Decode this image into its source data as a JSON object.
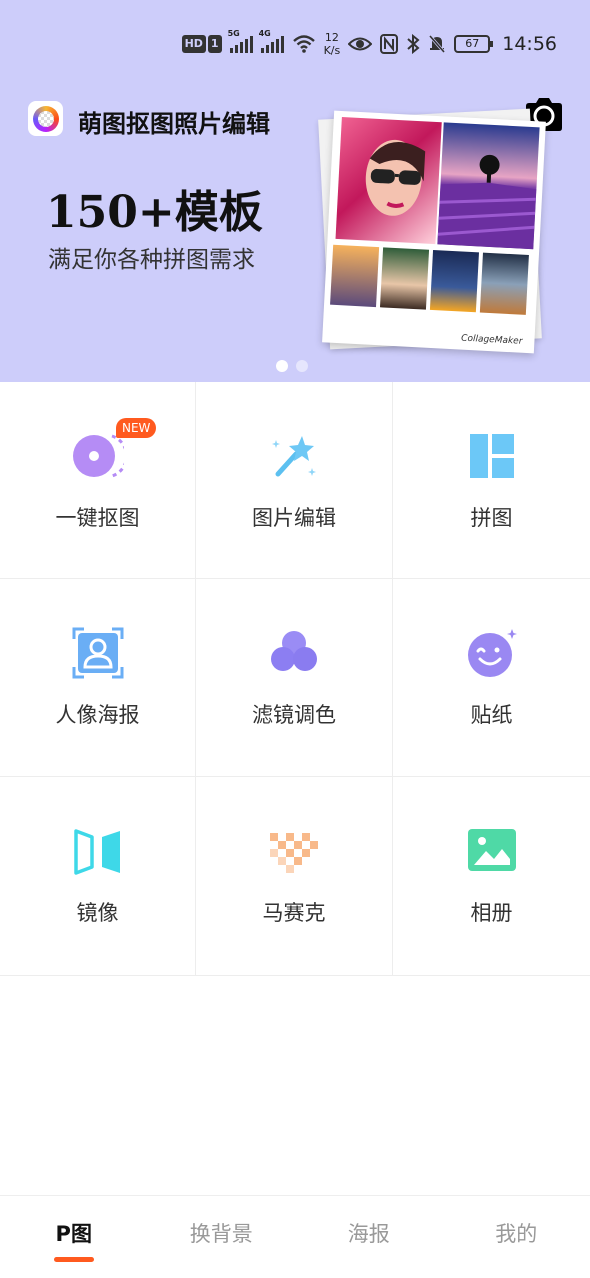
{
  "status_bar": {
    "hd_label": "HD",
    "sim_label": "1",
    "net1": "5G",
    "net2": "4G",
    "speed_value": "12",
    "speed_unit": "K/s",
    "battery": "67",
    "time": "14:56"
  },
  "banner": {
    "app_title": "萌图抠图照片编辑",
    "headline": "150+模板",
    "subtitle": "满足你各种拼图需求",
    "collage_caption": "CollageMaker",
    "page_dots": 2,
    "active_dot": 0
  },
  "features": [
    {
      "label": "一键抠图",
      "icon": "cutout-icon",
      "badge": "NEW"
    },
    {
      "label": "图片编辑",
      "icon": "magic-wand-icon"
    },
    {
      "label": "拼图",
      "icon": "collage-layout-icon"
    },
    {
      "label": "人像海报",
      "icon": "portrait-icon"
    },
    {
      "label": "滤镜调色",
      "icon": "filter-circles-icon"
    },
    {
      "label": "贴纸",
      "icon": "sticker-smile-icon"
    },
    {
      "label": "镜像",
      "icon": "mirror-icon"
    },
    {
      "label": "马赛克",
      "icon": "mosaic-icon"
    },
    {
      "label": "相册",
      "icon": "album-icon"
    }
  ],
  "bottom_nav": {
    "tabs": [
      {
        "label": "P图",
        "active": true
      },
      {
        "label": "换背景",
        "active": false
      },
      {
        "label": "海报",
        "active": false
      },
      {
        "label": "我的",
        "active": false
      }
    ]
  },
  "colors": {
    "banner_bg": "#cdcdfa",
    "accent": "#ff5a1f",
    "purple": "#b58cf5",
    "blue": "#6cc8f7",
    "cyan": "#3ed8e8",
    "green": "#4fd9a6",
    "peach": "#f8b98a"
  }
}
